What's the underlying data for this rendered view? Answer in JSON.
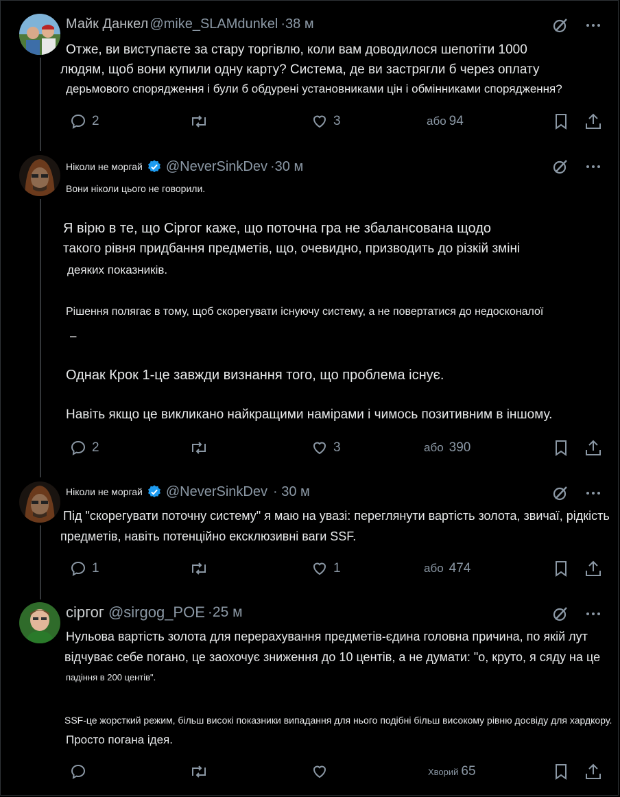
{
  "tweets": [
    {
      "name": "Майк Данкел",
      "handle": "@mike_SLAMdunkel",
      "time": "·38 м",
      "lines": [
        "Отже, ви виступаєте за стару торгівлю, коли вам доводилося шепотіти 1000",
        "людям, щоб вони купили одну карту? Система, де ви застрягли б через оплату",
        "дерьмового спорядження і були б обдурені установниками цін і обмінниками спорядження?"
      ],
      "replies": "2",
      "reposts": "",
      "likes": "3",
      "views_label": "або",
      "views": "94"
    },
    {
      "name": "Ніколи не моргай",
      "handle": "@NeverSinkDev",
      "time": "·30 м",
      "lines": [
        "Вони ніколи цього не говорили.",
        "Я вірю в те, що Сіргог каже, що поточна гра не збалансована щодо",
        "такого рівня придбання предметів, що, очевидно, призводить до різкій зміні",
        "деяких показників.",
        "Рішення полягає в тому, щоб скорегувати існуючу систему, а не повертатися до недосконалої",
        "–",
        "Однак Крок 1-це завжди визнання того, що проблема існує.",
        "Навіть якщо це викликано найкращими намірами і чимось позитивним в іншому."
      ],
      "replies": "2",
      "reposts": "",
      "likes": "3",
      "views_label": "або",
      "views": "390"
    },
    {
      "name": "Ніколи не моргай",
      "handle": "@NeverSinkDev",
      "time": "· 30 м",
      "lines": [
        "Під \"скорегувати поточну систему\" я маю на увазі: переглянути вартість золота, звичаї, рідкість",
        "предметів, навіть потенційно ексклюзивні ваги SSF."
      ],
      "replies": "1",
      "reposts": "",
      "likes": "1",
      "views_label": "або",
      "views": "474"
    },
    {
      "name": "сіргог",
      "handle": "@sirgog_POE",
      "time": "·25 м",
      "lines": [
        "Нульова вартість золота для перерахування предметів-єдина головна причина, по якій лут",
        "відчуває себе погано, це заохочує зниження до 10 центів, а не думати: \"о, круто, я сяду на це",
        "падіння в 200 центів\".",
        "SSF-це жорсткий режим, більш високі показники випадання для нього подібні більш високому рівню досвіду для хардкору.",
        "Просто погана ідея."
      ],
      "replies": "",
      "reposts": "",
      "likes": "",
      "views_label": "Хворий",
      "views": "65"
    }
  ],
  "icons": {
    "reply": "speech-bubble-icon",
    "repost": "repost-arrows-icon",
    "like": "heart-icon",
    "bookmark": "bookmark-icon",
    "share": "share-upload-icon",
    "grok": "grok-slash-circle-icon",
    "more": "more-dots-icon",
    "verified": "verified-badge-icon"
  },
  "colors": {
    "background": "#000000",
    "text": "#e7e9ea",
    "muted": "#8b98a5",
    "verified": "#1d9bf0",
    "thread_line": "#333639"
  }
}
